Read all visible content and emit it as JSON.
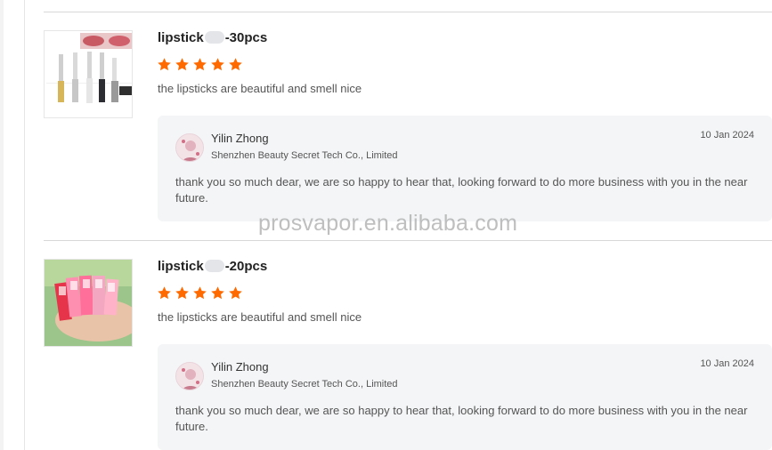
{
  "colors": {
    "star": "#ff6a00",
    "reply_bg": "#f4f5f7",
    "divider": "#d8d8d8"
  },
  "reviews": [
    {
      "title_prefix": "lipstick",
      "title_suffix": "-30pcs",
      "rating": 5,
      "comment": "the lipsticks are beautiful and smell nice",
      "reply": {
        "name": "Yilin Zhong",
        "company": "Shenzhen Beauty Secret Tech Co., Limited",
        "date": "10 Jan 2024",
        "text": "thank you so much dear, we are so happy to hear that, looking forward to do more business with you in the near future."
      }
    },
    {
      "title_prefix": "lipstick",
      "title_suffix": "-20pcs",
      "rating": 5,
      "comment": "the lipsticks are beautiful and smell nice",
      "reply": {
        "name": "Yilin Zhong",
        "company": "Shenzhen Beauty Secret Tech Co., Limited",
        "date": "10 Jan 2024",
        "text": "thank you so much dear, we are so happy to hear that, looking forward to do more business with you in the near future."
      }
    }
  ],
  "watermark": "prosvapor.en.alibaba.com"
}
